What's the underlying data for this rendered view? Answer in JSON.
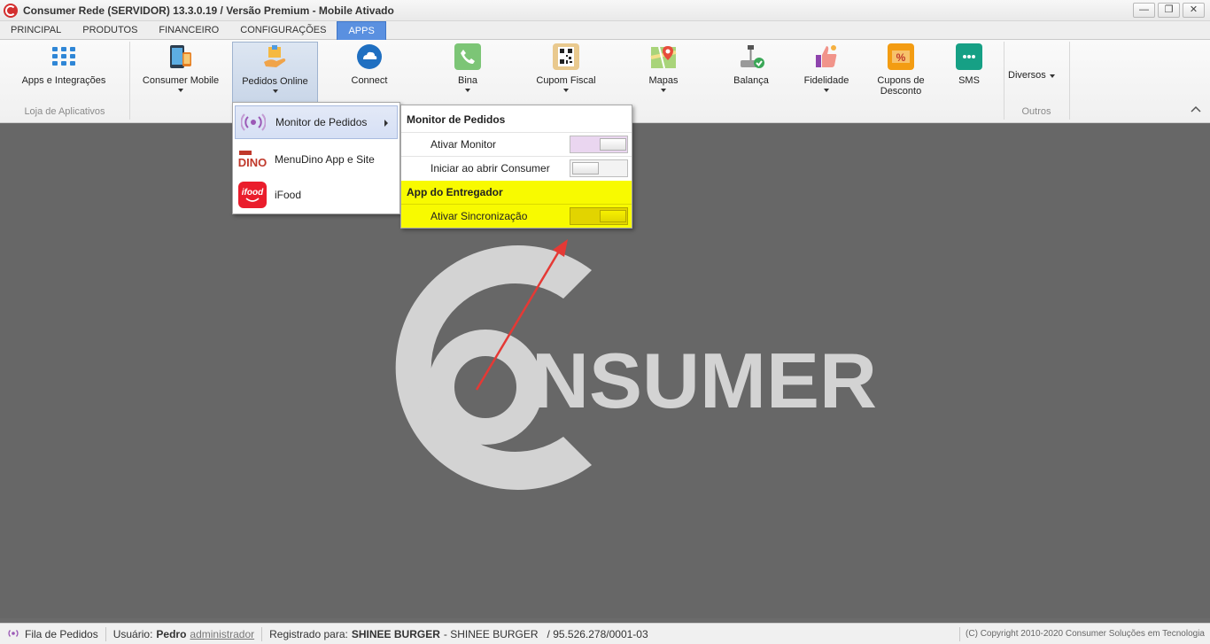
{
  "window": {
    "title": "Consumer Rede (SERVIDOR) 13.3.0.19 / Versão Premium - Mobile Ativado",
    "controls": {
      "minimize": "—",
      "restore": "❐",
      "close": "✕"
    }
  },
  "tabs": [
    "PRINCIPAL",
    "PRODUTOS",
    "FINANCEIRO",
    "CONFIGURAÇÕES",
    "APPS"
  ],
  "active_tab": "APPS",
  "ribbon": {
    "items": [
      {
        "label": "Apps e Integrações",
        "icon": "grid-icon"
      },
      {
        "label": "Consumer Mobile",
        "icon": "mobile-devices-icon"
      },
      {
        "label": "Pedidos Online",
        "icon": "online-orders-icon"
      },
      {
        "label": "Connect",
        "icon": "cloud-icon"
      },
      {
        "label": "Bina",
        "icon": "phone-icon"
      },
      {
        "label": "Cupom Fiscal",
        "icon": "qrcode-icon"
      },
      {
        "label": "Mapas",
        "icon": "map-icon"
      },
      {
        "label": "Balança",
        "icon": "scale-icon"
      },
      {
        "label": "Fidelidade",
        "icon": "thumbs-up-icon"
      },
      {
        "label": "Cupons de",
        "label2": "Desconto",
        "icon": "coupon-icon"
      },
      {
        "label": "SMS",
        "icon": "sms-icon"
      },
      {
        "label": "Diversos",
        "icon": "dropdown-icon"
      }
    ],
    "groups": {
      "loja": "Loja de Aplicativos",
      "outros": "Outros"
    },
    "colors": {
      "accent": "#5a90e0"
    }
  },
  "pedidos_menu": {
    "items": [
      {
        "label": "Monitor de Pedidos",
        "icon": "broadcast-icon"
      },
      {
        "label": "MenuDino App e Site",
        "icon": "menudino-logo-icon"
      },
      {
        "label": "iFood",
        "icon": "ifood-logo-icon"
      }
    ]
  },
  "monitor_submenu": {
    "header1": "Monitor de Pedidos",
    "rows1": [
      {
        "label": "Ativar Monitor",
        "state": "on"
      },
      {
        "label": "Iniciar ao abrir Consumer",
        "state": "off"
      }
    ],
    "header2": "App do Entregador",
    "rows2": [
      {
        "label": "Ativar Sincronização",
        "state": "on"
      }
    ],
    "highlight_color": "#f8fa00"
  },
  "background_logo": {
    "text": "NSUMER"
  },
  "statusbar": {
    "queue": "Fila de Pedidos",
    "user_label": "Usuário:",
    "user_name": "Pedro",
    "user_role": "administrador",
    "registered_label": "Registrado para:",
    "registered_name": "SHINEE BURGER",
    "registered_rest": "- SHINEE BURGER   / 95.526.278/0001-03",
    "copyright": "(C) Copyright 2010-2020 Consumer Soluções em Tecnologia"
  }
}
